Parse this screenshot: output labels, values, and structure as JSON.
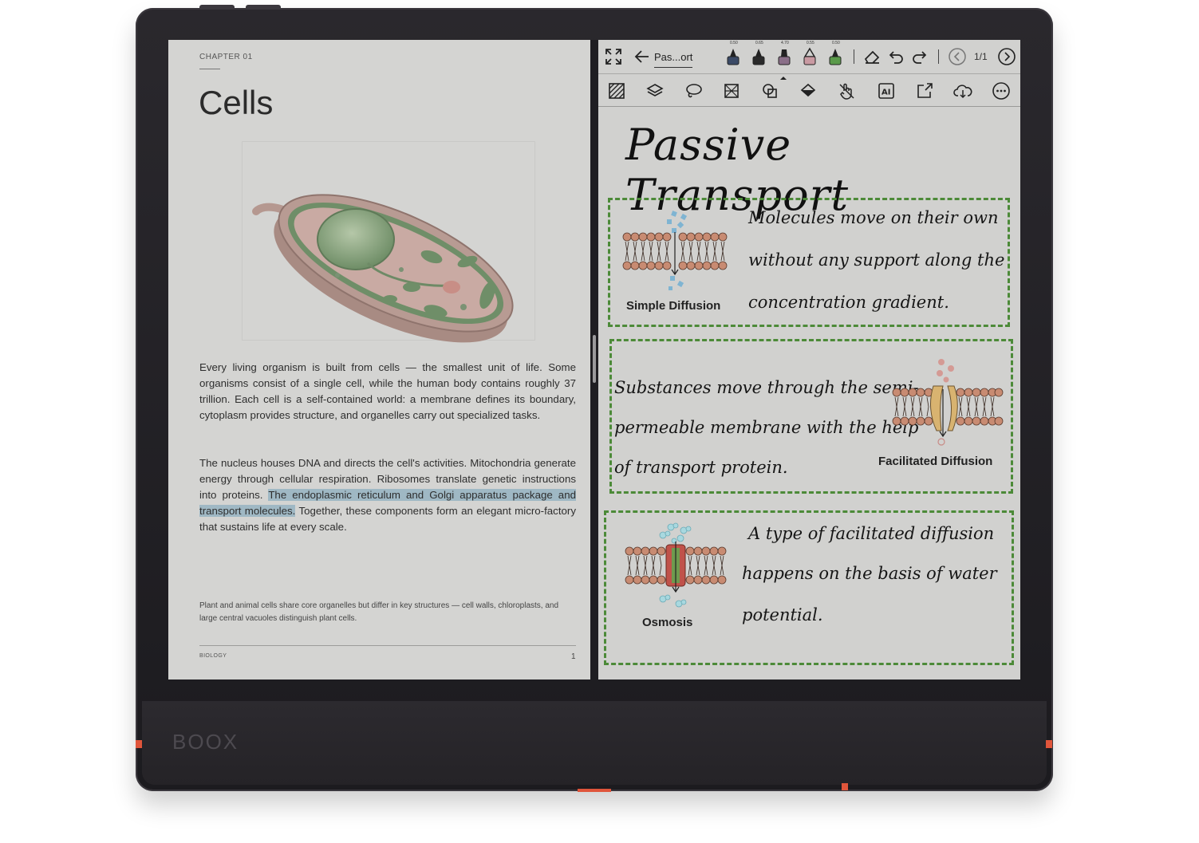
{
  "device": {
    "brand": "BOOX"
  },
  "reader": {
    "chapter": "CHAPTER 01",
    "title": "Cells",
    "paragraph1": "Every living organism is built from cells — the smallest unit of life. Some organisms consist of a single cell, while the human body contains roughly 37 trillion. Each cell is a self-contained world: a membrane defines its boundary, cytoplasm provides structure, and organelles carry out specialized tasks.",
    "paragraph2_before": "The nucleus houses DNA and directs the cell's activities. Mitochondria generate energy through cellular respiration. Ribosomes translate genetic instructions into proteins. ",
    "paragraph2_highlight": "The endoplasmic reticulum and Golgi apparatus package and transport molecules.",
    "paragraph2_after": " Together, these components form an elegant micro-factory that sustains life at every scale.",
    "footnote": "Plant and animal cells share core organelles but differ in key structures — cell walls, chloroplasts, and large central vacuoles distinguish plant cells.",
    "footer_label": "BIOLOGY",
    "page_number": "1",
    "highlight_color": "#9fb8c4"
  },
  "notes": {
    "doc_name": "Pas...ort",
    "page_counter": "1/1",
    "pen_sizes": [
      "0.50",
      "0.65",
      "4.70",
      "0.55",
      "0.50"
    ],
    "title": "Passive Transport",
    "box_color": "#4c8a38",
    "sections": [
      {
        "label": "Simple Diffusion",
        "lines": [
          "Molecules move on their own",
          "without any support along the",
          "concentration gradient."
        ]
      },
      {
        "label": "Facilitated Diffusion",
        "lines": [
          "Substances move through the semi-",
          "permeable membrane with the help",
          "of transport protein."
        ]
      },
      {
        "label": "Osmosis",
        "lines": [
          "A type of facilitated diffusion",
          "happens on the basis of water",
          "potential."
        ]
      }
    ],
    "toolbar_icons": [
      "expand-icon",
      "back-arrow-icon",
      "eraser-icon",
      "undo-icon",
      "redo-icon",
      "prev-page-icon",
      "next-page-icon"
    ],
    "toolbar2_icons": [
      "pattern-icon",
      "layers-icon",
      "lasso-icon",
      "crop-icon",
      "shapes-icon",
      "fill-icon",
      "touch-icon",
      "ai-icon",
      "share-icon",
      "cloud-sync-icon",
      "more-icon"
    ]
  }
}
